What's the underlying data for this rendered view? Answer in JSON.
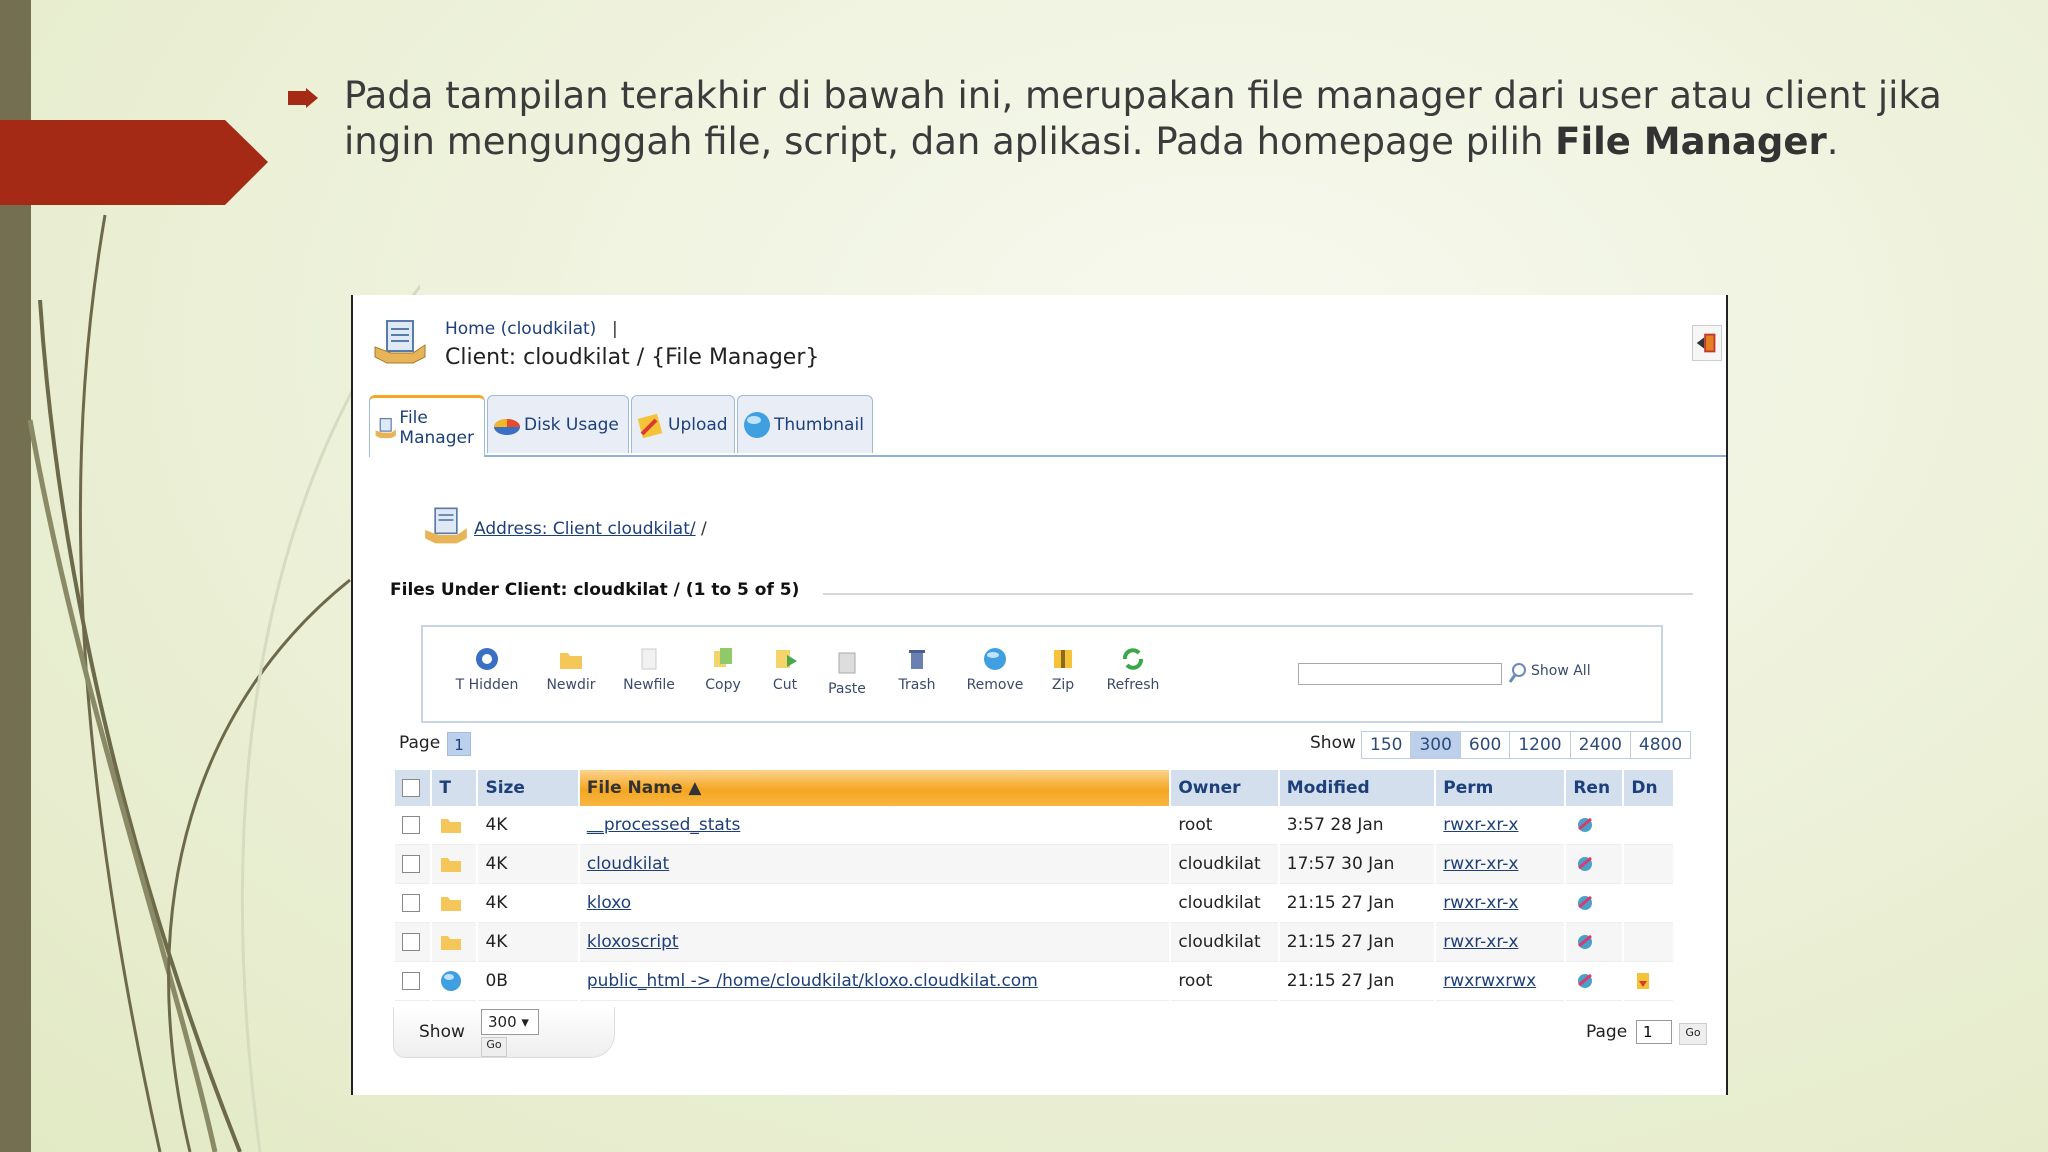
{
  "slide": {
    "text_part1": "Pada tampilan terakhir di bawah ini, merupakan file manager dari user atau client jika ingin mengunggah file, script, dan aplikasi. Pada homepage pilih ",
    "text_bold": "File Manager",
    "text_end": "."
  },
  "colors": {
    "accent_red": "#a52a16",
    "left_bar": "#756f52",
    "tab_active": "#f5a623",
    "link": "#1d3f7a"
  },
  "app": {
    "breadcrumb_home": "Home (cloudkilat)",
    "breadcrumb_sep": "|",
    "page_title": "Client: cloudkilat / {File Manager}",
    "tabs": [
      {
        "label": "File Manager",
        "icon": "file-manager-icon"
      },
      {
        "label": "Disk Usage",
        "icon": "pie-chart-icon"
      },
      {
        "label": "Upload",
        "icon": "upload-icon"
      },
      {
        "label": "Thumbnail",
        "icon": "globe-icon"
      }
    ],
    "address_link": "Address: Client cloudkilat/",
    "address_tail": " /",
    "files_heading": "Files Under Client: cloudkilat / (1 to 5 of 5)",
    "toolbar": [
      {
        "label": "T Hidden",
        "icon": "hidden-icon"
      },
      {
        "label": "Newdir",
        "icon": "new-folder-icon"
      },
      {
        "label": "Newfile",
        "icon": "new-file-icon"
      },
      {
        "label": "Copy",
        "icon": "copy-icon"
      },
      {
        "label": "Cut",
        "icon": "cut-icon"
      },
      {
        "label": "Paste",
        "icon": "paste-icon"
      },
      {
        "label": "Trash",
        "icon": "trash-icon"
      },
      {
        "label": "Remove",
        "icon": "remove-icon"
      },
      {
        "label": "Zip",
        "icon": "zip-icon"
      },
      {
        "label": "Refresh",
        "icon": "refresh-icon"
      }
    ],
    "search_value": "",
    "show_all": "Show All",
    "page_label": "Page",
    "page_current": "1",
    "show_label": "Show",
    "show_options": [
      "150",
      "300",
      "600",
      "1200",
      "2400",
      "4800"
    ],
    "show_selected": "300",
    "columns": [
      "T",
      "Size",
      "File Name",
      "Owner",
      "Modified",
      "Perm",
      "Ren",
      "Dn"
    ],
    "rows": [
      {
        "type": "folder",
        "size": "4K",
        "name": "__processed_stats",
        "owner": "root",
        "modified": "3:57 28 Jan",
        "perm": "rwxr-xr-x"
      },
      {
        "type": "folder",
        "size": "4K",
        "name": "cloudkilat",
        "owner": "cloudkilat",
        "modified": "17:57 30 Jan",
        "perm": "rwxr-xr-x"
      },
      {
        "type": "folder",
        "size": "4K",
        "name": "kloxo",
        "owner": "cloudkilat",
        "modified": "21:15 27 Jan",
        "perm": "rwxr-xr-x"
      },
      {
        "type": "folder",
        "size": "4K",
        "name": "kloxoscript",
        "owner": "cloudkilat",
        "modified": "21:15 27 Jan",
        "perm": "rwxr-xr-x"
      },
      {
        "type": "link",
        "size": "0B",
        "name": "public_html -> /home/cloudkilat/kloxo.cloudkilat.com",
        "owner": "root",
        "modified": "21:15 27 Jan",
        "perm": "rwxrwxrwx"
      }
    ],
    "footer": {
      "show_label": "Show",
      "show_value": "300",
      "go": "Go",
      "page_label": "Page",
      "page_value": "1",
      "page_go": "Go"
    }
  }
}
